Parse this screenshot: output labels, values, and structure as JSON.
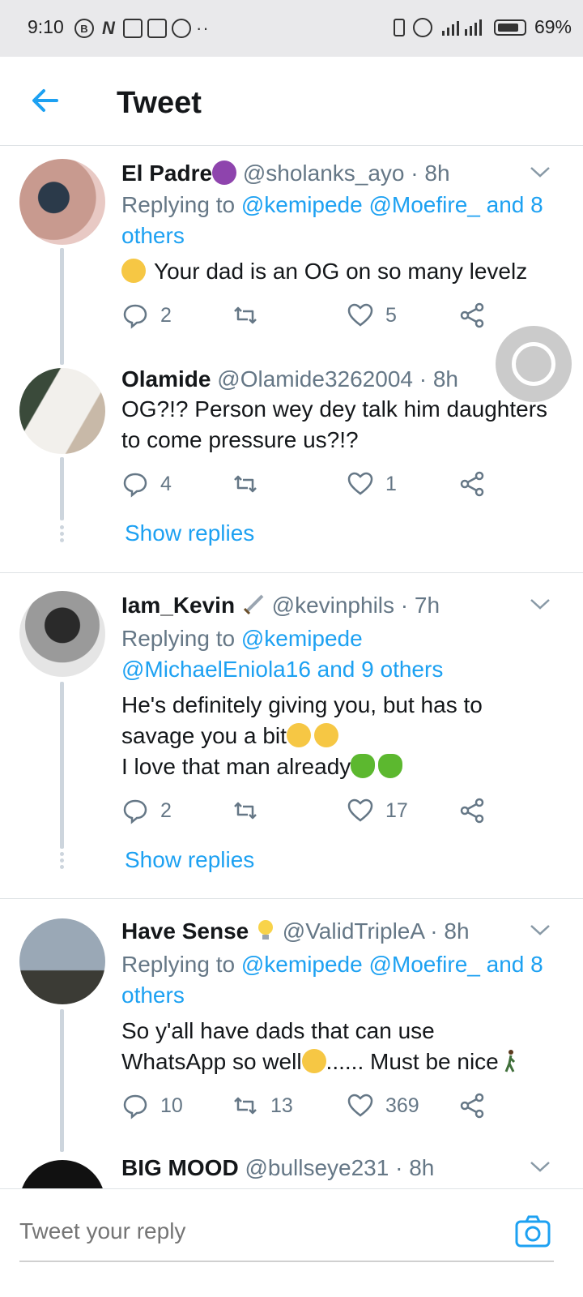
{
  "status_bar": {
    "time": "9:10",
    "battery": "69%",
    "left_icons": [
      "B",
      "N"
    ]
  },
  "header": {
    "title": "Tweet"
  },
  "tweets": [
    {
      "name": "El Padre",
      "name_emoji": "smiling-devil-emoji",
      "handle": "@sholanks_ayo",
      "time": "· 8h",
      "reply_prefix": "Replying to",
      "reply_links": "@kemipede @Moefire_ and 8 others",
      "text": "Your dad is an OG on so many levelz",
      "replies": "2",
      "retweets": "",
      "likes": "5"
    },
    {
      "name": "Olamide",
      "handle": "@Olamide3262004",
      "time": "· 8h",
      "text": "OG?!? Person wey dey talk him daughters to come pressure us?!?",
      "replies": "4",
      "retweets": "",
      "likes": "1",
      "show_replies": "Show replies"
    },
    {
      "name": "Iam_Kevin",
      "name_emoji": "sword-emoji",
      "handle": "@kevinphils",
      "time": "· 7h",
      "reply_prefix": "Replying to",
      "reply_link_1": "@kemipede",
      "reply_link_2": "@MichaelEniola16 and 9 others",
      "text_line1": "He's definitely giving you, but has to",
      "text_line2": "savage you a bit",
      "text_line3": "I love that man already",
      "replies": "2",
      "retweets": "",
      "likes": "17",
      "show_replies": "Show replies"
    },
    {
      "name": "Have Sense",
      "name_emoji": "lightbulb-emoji",
      "handle": "@ValidTripleA",
      "time": "· 8h",
      "reply_prefix": "Replying to",
      "reply_links": "@kemipede @Moefire_ and 8 others",
      "text_line1": "So y'all have dads that can use",
      "text_line2": "WhatsApp so well",
      "text_line2b": "...... Must be nice",
      "replies": "10",
      "retweets": "13",
      "likes": "369"
    },
    {
      "name": "BIG MOOD",
      "handle": "@bullseye231",
      "time": "· 8h"
    }
  ],
  "reply_bar": {
    "placeholder": "Tweet your reply"
  },
  "colors": {
    "accent": "#1da1f2",
    "secondary_text": "#657786",
    "primary_text": "#14171a"
  }
}
